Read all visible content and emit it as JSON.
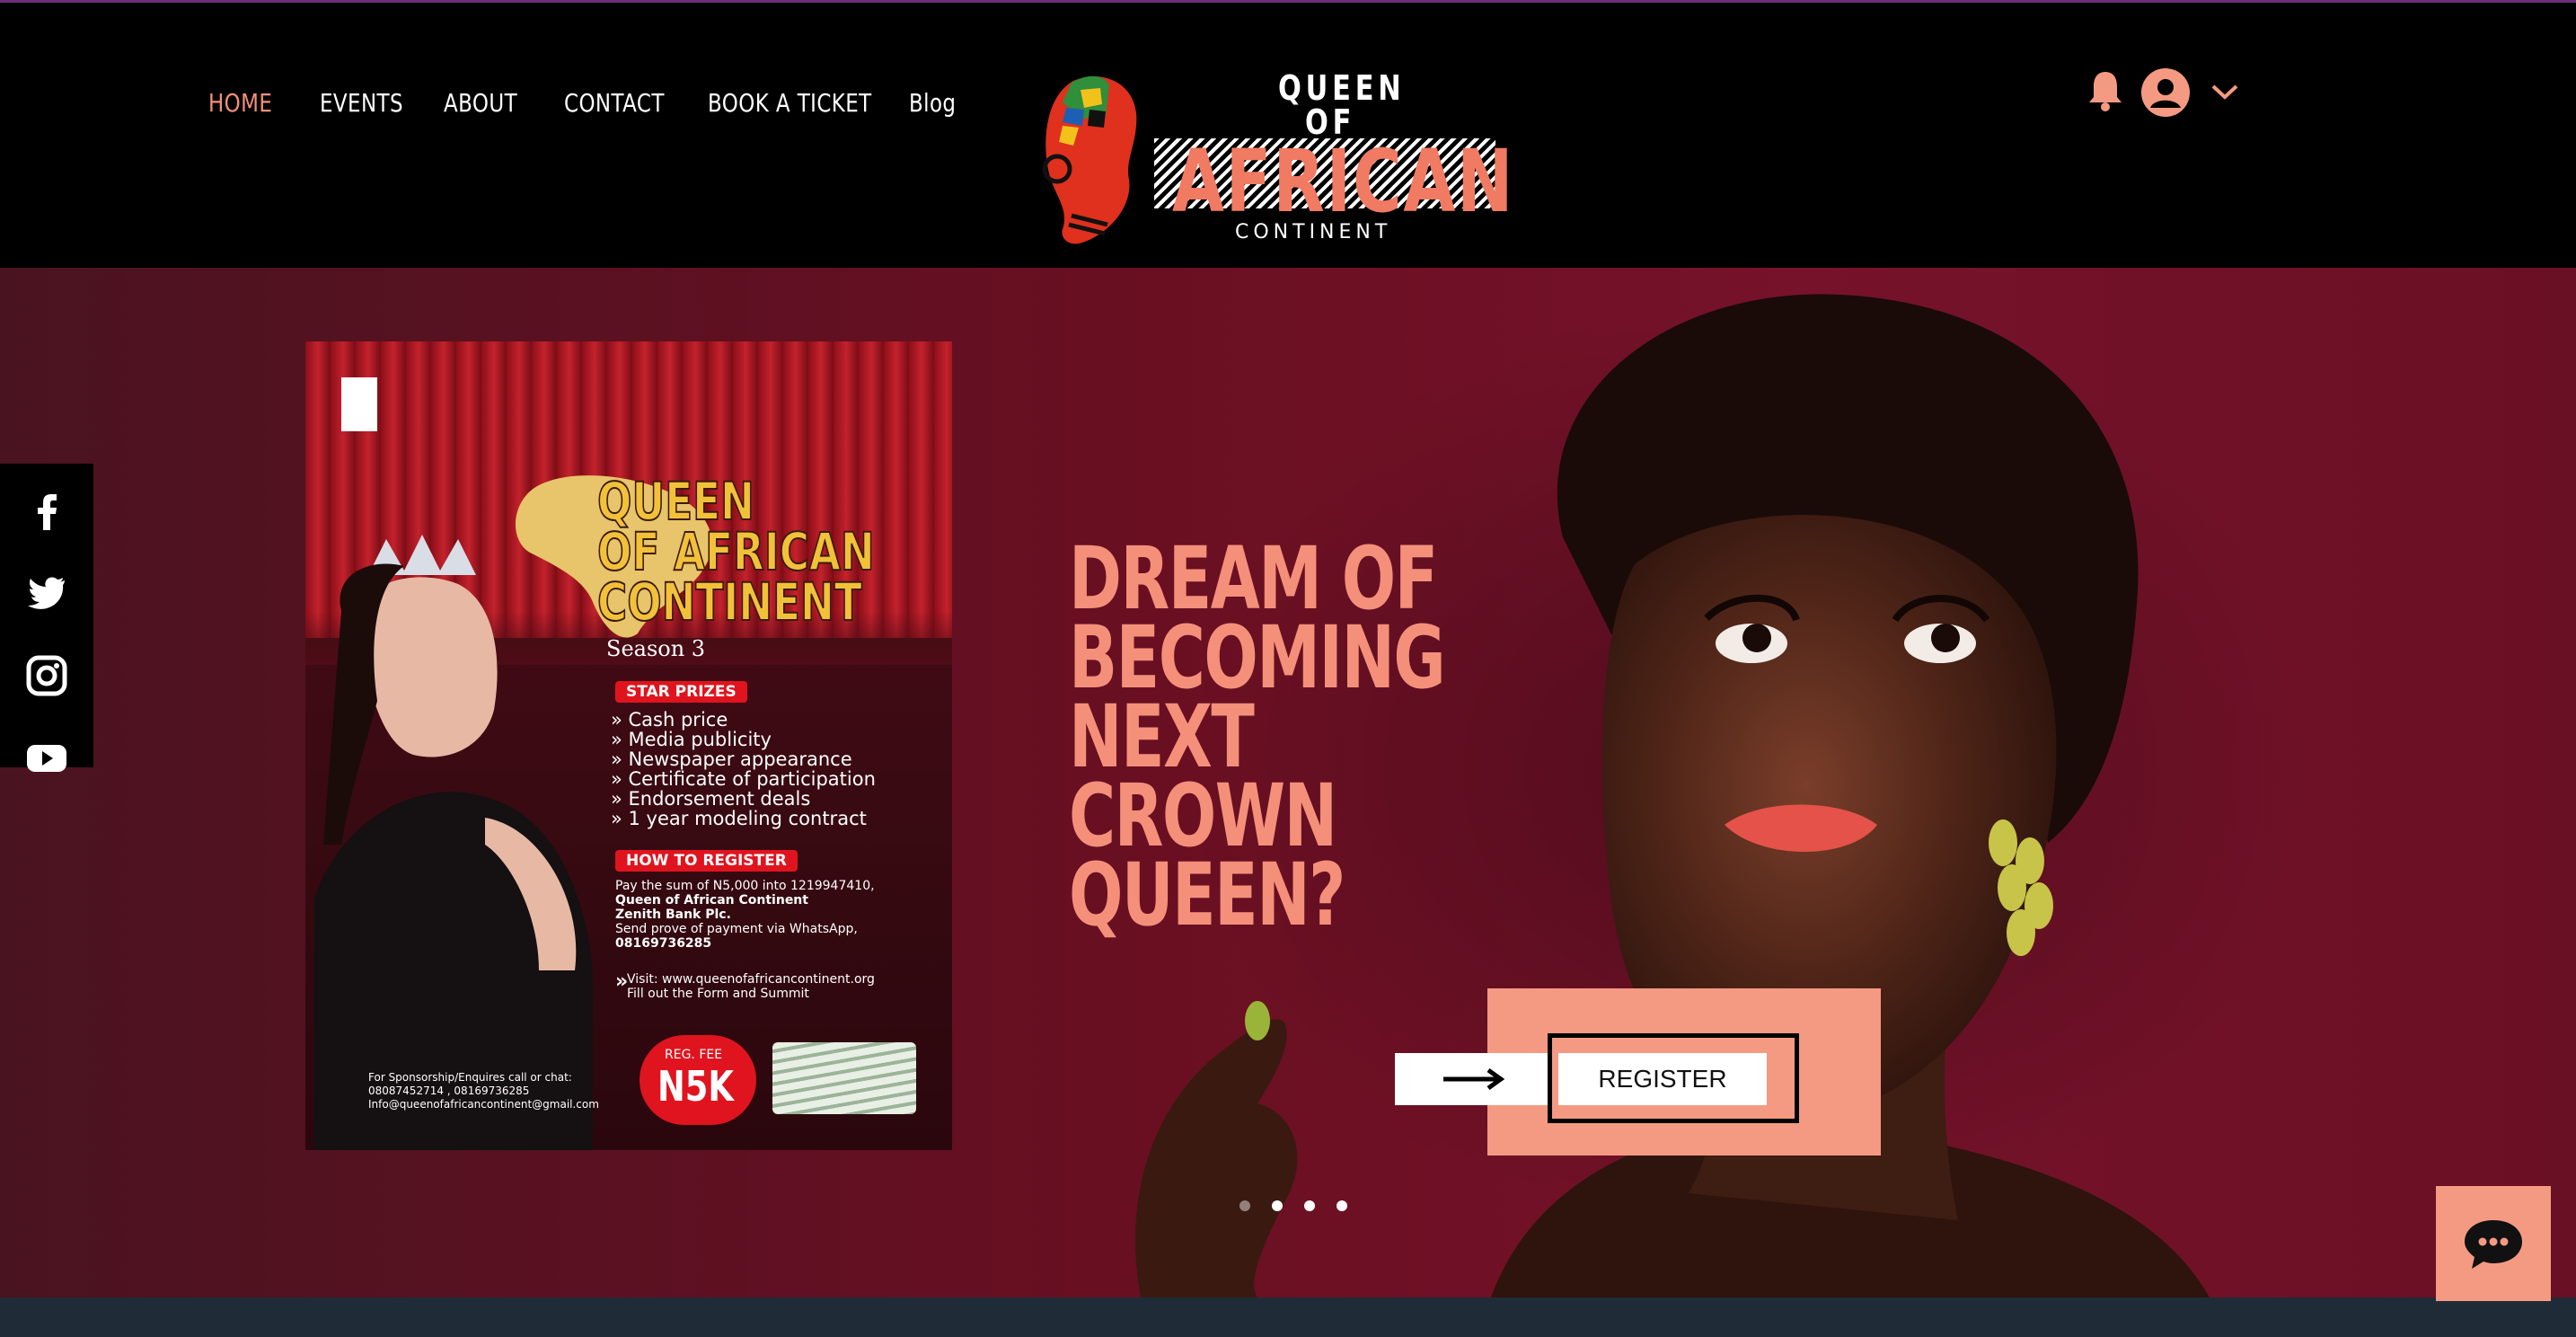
{
  "nav": {
    "items": [
      {
        "label": "HOME",
        "active": true
      },
      {
        "label": "EVENTS"
      },
      {
        "label": "ABOUT"
      },
      {
        "label": "CONTACT"
      },
      {
        "label": "BOOK A TICKET"
      },
      {
        "label": "Blog"
      }
    ]
  },
  "logo": {
    "line1": "QUEEN",
    "line2": "OF",
    "line3": "AFRICAN",
    "line4": "CONTINENT"
  },
  "header_actions": {
    "bell_icon": "bell-icon",
    "avatar_icon": "user-avatar-icon",
    "menu_icon": "chevron-down-icon"
  },
  "social": [
    "facebook-icon",
    "twitter-icon",
    "instagram-icon",
    "youtube-icon"
  ],
  "poster": {
    "title_line1": "QUEEN",
    "title_line2": "OF AFRICAN",
    "title_line3": "CONTINENT",
    "season": "Season 3",
    "prizes_badge": "STAR PRIZES",
    "prizes": [
      "» Cash price",
      "» Media publicity",
      "» Newspaper appearance",
      "» Certificate of participation",
      "» Endorsement deals",
      "» 1 year modeling contract"
    ],
    "register_badge": "HOW TO REGISTER",
    "register_lines": [
      "Pay the sum of N5,000 into 1219947410,",
      "Queen of African Continent",
      "Zenith Bank Plc.",
      "Send prove of payment via WhatsApp,",
      "08169736285"
    ],
    "visit_line1": "Visit: www.queenofafricancontinent.org",
    "visit_line2": "Fill out the Form and Summit",
    "contact_lines": [
      "For Sponsorship/Enquires call or chat:",
      "08087452714 , 08169736285",
      "Info@queenofafricancontinent@gmail.com"
    ],
    "fee_label": "REG. FEE",
    "fee_value": "N5K"
  },
  "hero": {
    "headline": [
      "DREAM OF",
      "BECOMING",
      "NEXT",
      "CROWN",
      "QUEEN?"
    ],
    "register_label": "REGISTER",
    "slides_total": 4,
    "slide_active": 1
  },
  "colors": {
    "accent": "#f4907a",
    "hero_bg": "#6a0f22",
    "header_bg": "#000000",
    "footer_strip": "#1f2c38"
  },
  "chat": {
    "icon": "chat-bubble-icon"
  }
}
